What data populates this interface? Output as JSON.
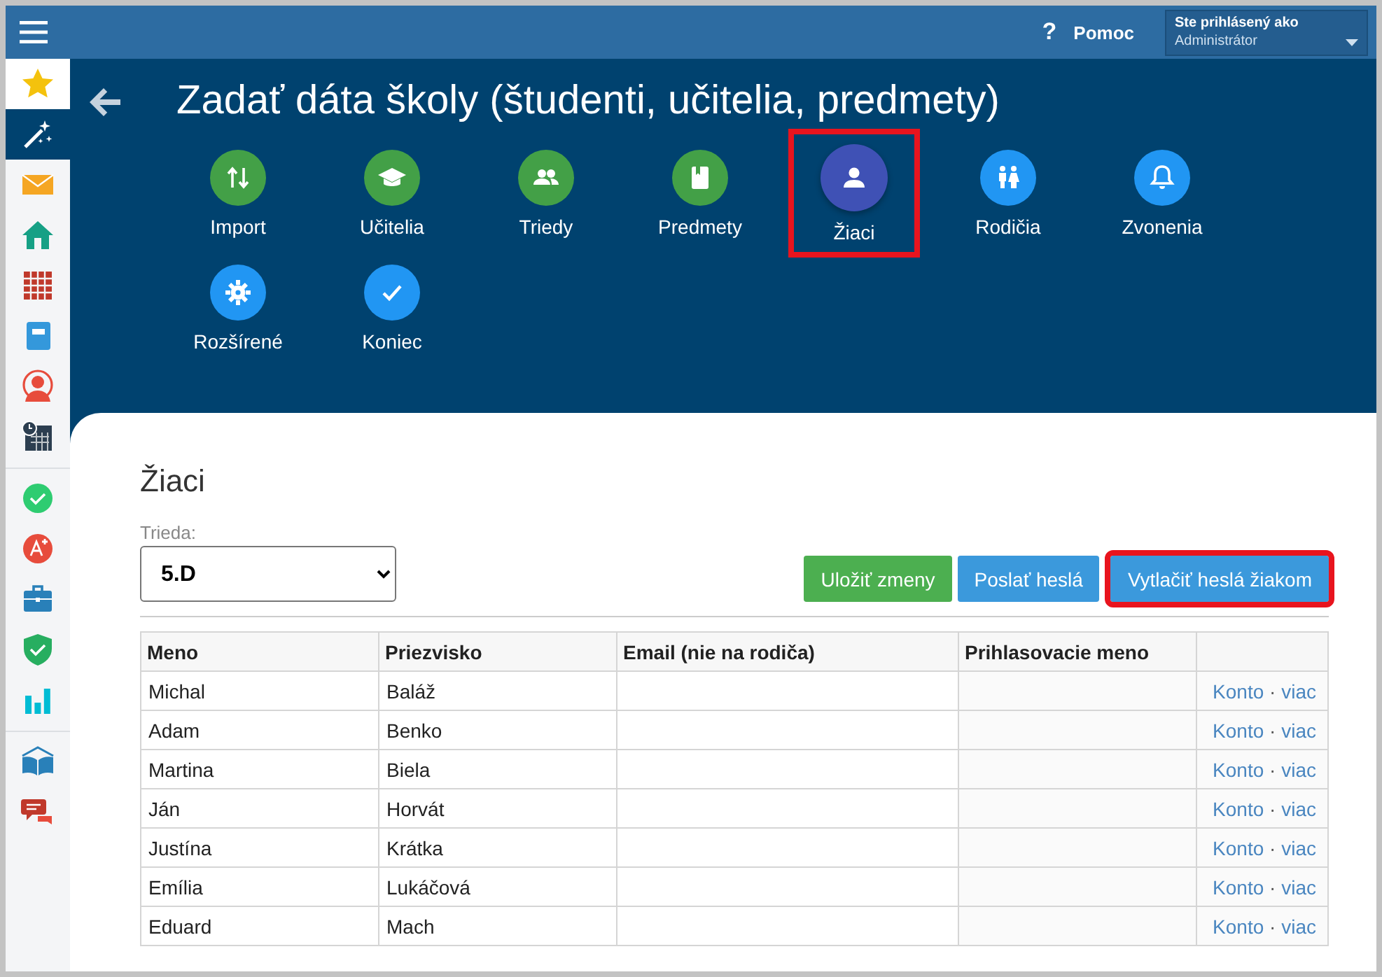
{
  "top_bar": {
    "help": {
      "icon_text": "?",
      "label": "Pomoc"
    },
    "user": {
      "caption": "Ste prihlásený ako",
      "value": "Administrátor"
    }
  },
  "sidebar": {
    "groups": [
      [
        {
          "selected": false
        },
        {
          "selected": true
        },
        {
          "selected": false
        },
        {
          "selected": false
        },
        {
          "selected": false
        },
        {
          "selected": false
        },
        {
          "selected": false
        },
        {
          "selected": false
        }
      ],
      [
        {
          "selected": false
        },
        {
          "selected": false
        },
        {
          "selected": false
        },
        {
          "selected": false
        },
        {
          "selected": false
        }
      ],
      [
        {
          "selected": false
        },
        {
          "selected": false
        }
      ]
    ]
  },
  "header": {
    "title": "Zadať dáta školy (študenti, učitelia, predmety)"
  },
  "steps": [
    {
      "label": "Import",
      "kind": "done",
      "highlighted": false
    },
    {
      "label": "Učitelia",
      "kind": "done",
      "highlighted": false
    },
    {
      "label": "Triedy",
      "kind": "done",
      "highlighted": false
    },
    {
      "label": "Predmety",
      "kind": "done",
      "highlighted": false
    },
    {
      "label": "Žiaci",
      "kind": "current",
      "highlighted": true
    },
    {
      "label": "Rodičia",
      "kind": "todo",
      "highlighted": false
    },
    {
      "label": "Zvonenia",
      "kind": "todo",
      "highlighted": false
    },
    {
      "label": "Rozšírené",
      "kind": "todo",
      "highlighted": false
    },
    {
      "label": "Koniec",
      "kind": "todo",
      "highlighted": false
    }
  ],
  "panel": {
    "title": "Žiaci",
    "class_select": {
      "label": "Trieda:",
      "value": "5.D"
    },
    "buttons": [
      {
        "label": "Uložiť zmeny",
        "kind": "success",
        "highlighted": false
      },
      {
        "label": "Poslať heslá",
        "kind": "info",
        "highlighted": false
      },
      {
        "label": "Vytlačiť heslá žiakom",
        "kind": "info",
        "highlighted": true
      }
    ],
    "table": {
      "columns": [
        "Meno",
        "Priezvisko",
        "Email (nie na rodiča)",
        "Prihlasovacie meno"
      ],
      "rows": [
        {
          "first_name": "Michal",
          "last_name": "Baláž",
          "account": "Konto",
          "separator": "·",
          "more": "viac"
        },
        {
          "first_name": "Adam",
          "last_name": "Benko",
          "account": "Konto",
          "separator": "·",
          "more": "viac"
        },
        {
          "first_name": "Martina",
          "last_name": "Biela",
          "account": "Konto",
          "separator": "·",
          "more": "viac"
        },
        {
          "first_name": "Ján",
          "last_name": "Horvát",
          "account": "Konto",
          "separator": "·",
          "more": "viac"
        },
        {
          "first_name": "Justína",
          "last_name": "Krátka",
          "account": "Konto",
          "separator": "·",
          "more": "viac"
        },
        {
          "first_name": "Emília",
          "last_name": "Lukáčová",
          "account": "Konto",
          "separator": "·",
          "more": "viac"
        },
        {
          "first_name": "Eduard",
          "last_name": "Mach",
          "account": "Konto",
          "separator": "·",
          "more": "viac"
        }
      ]
    }
  }
}
